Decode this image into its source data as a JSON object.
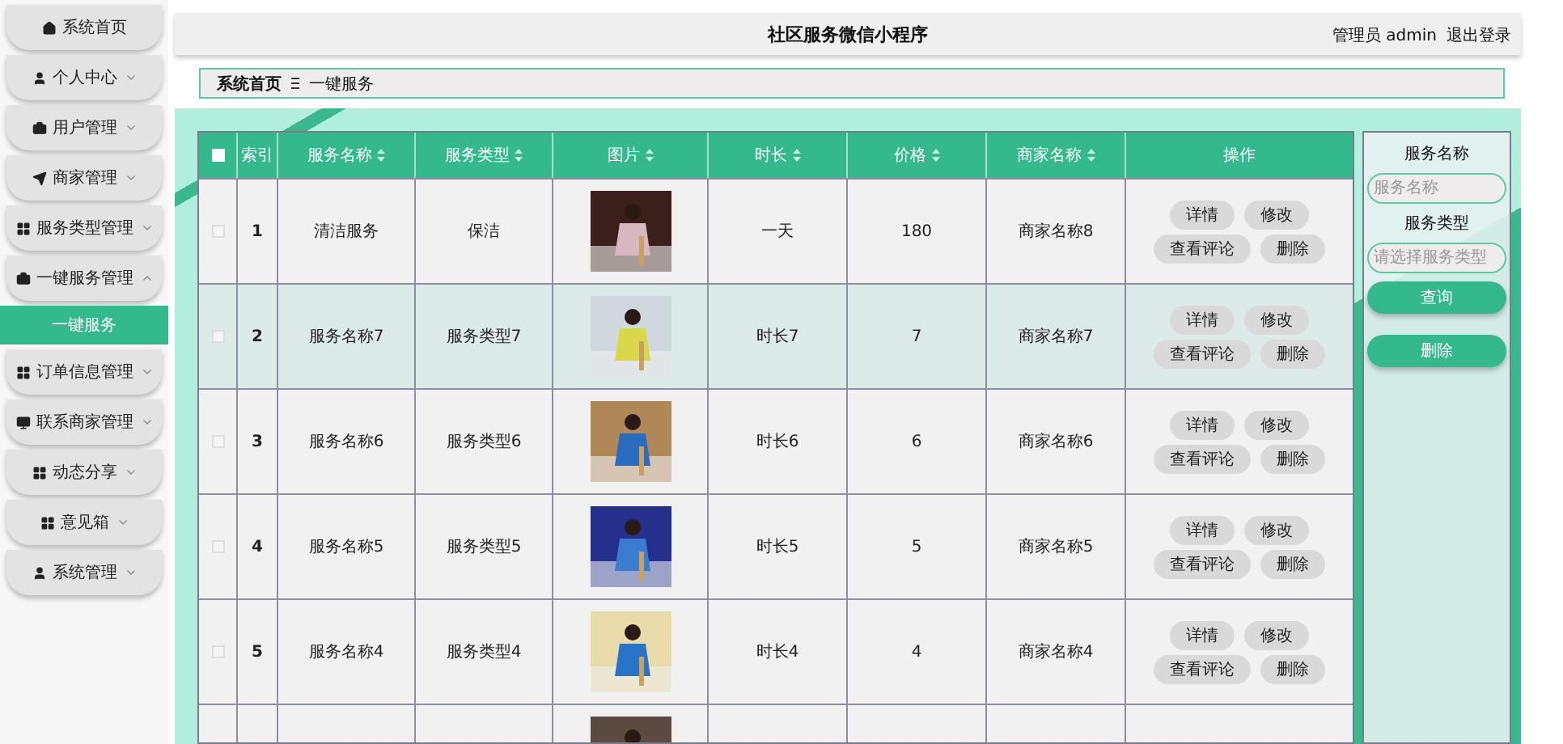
{
  "sidebar": {
    "items": [
      {
        "label": "系统首页"
      },
      {
        "label": "个人中心",
        "expanded": false
      },
      {
        "label": "用户管理",
        "expanded": false
      },
      {
        "label": "商家管理",
        "expanded": false
      },
      {
        "label": "服务类型管理",
        "expanded": false
      },
      {
        "label": "一键服务管理",
        "expanded": true,
        "children": [
          {
            "label": "一键服务",
            "selected": true
          }
        ]
      },
      {
        "label": "订单信息管理",
        "expanded": false
      },
      {
        "label": "联系商家管理",
        "expanded": false
      },
      {
        "label": "动态分享",
        "expanded": false
      },
      {
        "label": "意见箱",
        "expanded": false
      },
      {
        "label": "系统管理",
        "expanded": false
      }
    ]
  },
  "header": {
    "title": "社区服务微信小程序",
    "user": "管理员 admin",
    "logout": "退出登录"
  },
  "breadcrumb": [
    "系统首页",
    "一键服务"
  ],
  "table": {
    "select_all": {
      "checked": false
    },
    "columns": [
      {
        "label": "索引",
        "sortable": false
      },
      {
        "label": "服务名称",
        "sortable": true
      },
      {
        "label": "服务类型",
        "sortable": true
      },
      {
        "label": "图片",
        "sortable": true
      },
      {
        "label": "时长",
        "sortable": true
      },
      {
        "label": "价格",
        "sortable": true
      },
      {
        "label": "商家名称",
        "sortable": true
      },
      {
        "label": "操作",
        "sortable": false
      }
    ],
    "rows": [
      {
        "checked": false,
        "selected": false,
        "index": "1",
        "name": "清洁服务",
        "type": "保洁",
        "duration": "一天",
        "price": "180",
        "merchant": "商家名称8",
        "actions": [
          "详情",
          "修改",
          "查看评论",
          "删除"
        ]
      },
      {
        "checked": false,
        "selected": true,
        "index": "2",
        "name": "服务名称7",
        "type": "服务类型7",
        "duration": "时长7",
        "price": "7",
        "merchant": "商家名称7",
        "actions": [
          "详情",
          "修改",
          "查看评论",
          "删除"
        ]
      },
      {
        "checked": false,
        "selected": false,
        "index": "3",
        "name": "服务名称6",
        "type": "服务类型6",
        "duration": "时长6",
        "price": "6",
        "merchant": "商家名称6",
        "actions": [
          "详情",
          "修改",
          "查看评论",
          "删除"
        ]
      },
      {
        "checked": false,
        "selected": false,
        "index": "4",
        "name": "服务名称5",
        "type": "服务类型5",
        "duration": "时长5",
        "price": "5",
        "merchant": "商家名称5",
        "actions": [
          "详情",
          "修改",
          "查看评论",
          "删除"
        ]
      },
      {
        "checked": false,
        "selected": false,
        "index": "5",
        "name": "服务名称4",
        "type": "服务类型4",
        "duration": "时长4",
        "price": "4",
        "merchant": "商家名称4",
        "actions": [
          "详情",
          "修改",
          "查看评论",
          "删除"
        ]
      },
      {
        "selected": false
      }
    ]
  },
  "search_panel": {
    "fields": [
      {
        "label": "服务名称",
        "placeholder": "服务名称"
      },
      {
        "label": "服务类型",
        "placeholder": "请选择服务类型"
      }
    ],
    "buttons": [
      "查询",
      "删除"
    ]
  }
}
